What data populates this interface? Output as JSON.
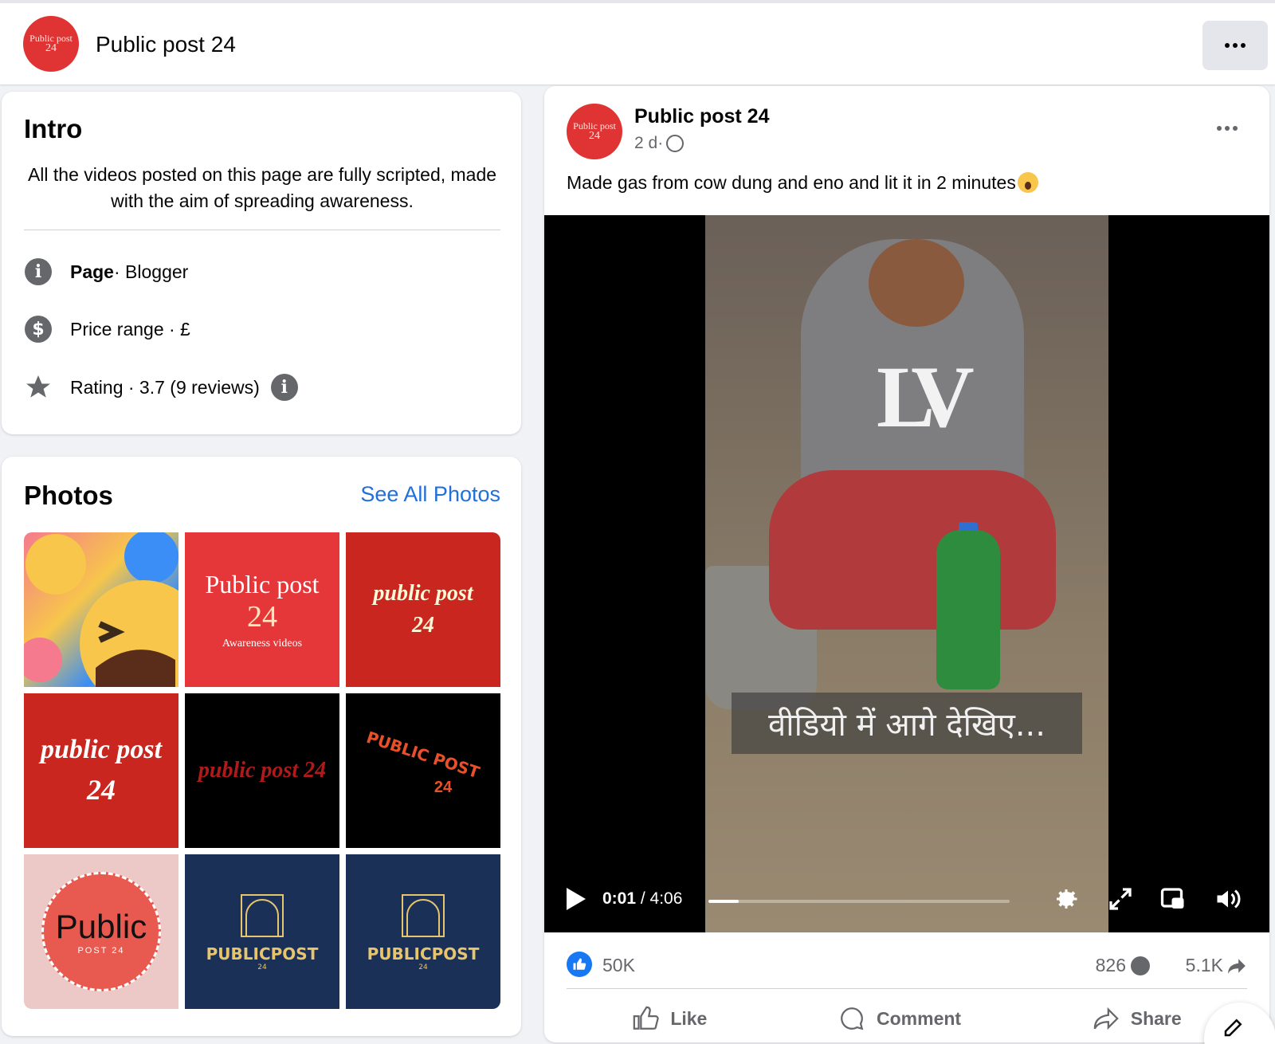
{
  "header": {
    "avatar_text_line1": "Public post",
    "avatar_text_line2": "24",
    "title": "Public post 24"
  },
  "intro": {
    "heading": "Intro",
    "bio": "All the videos posted on this page are fully scripted, made with the aim of spreading awareness.",
    "page_label": "Page",
    "page_category": " · Blogger",
    "price_range": "Price range · £",
    "rating": "Rating · 3.7 (9 reviews)"
  },
  "photos": {
    "heading": "Photos",
    "see_all": "See All Photos",
    "tiles": [
      {
        "kind": "emoji"
      },
      {
        "kind": "logo",
        "line1": "Public post",
        "line2": "24",
        "line3": "Awareness videos"
      },
      {
        "kind": "logo",
        "line1": "public post",
        "line2": "24"
      },
      {
        "kind": "logo",
        "line1": "public post",
        "line2": "24"
      },
      {
        "kind": "logo",
        "line1": "public post 24"
      },
      {
        "kind": "logo",
        "line1": "PUBLIC POST",
        "line2": "24"
      },
      {
        "kind": "logo",
        "line1": "Public",
        "line2": "POST 24"
      },
      {
        "kind": "logo",
        "line1": "PUBLICPOST",
        "line2": "24"
      },
      {
        "kind": "logo",
        "line1": "PUBLICPOST",
        "line2": "24"
      }
    ]
  },
  "post": {
    "author": "Public post 24",
    "time": "2 d·",
    "caption": "Made gas from cow dung and eno and lit it in 2 minutes",
    "video": {
      "subtitle": "वीडियो में आगे देखिए...",
      "shirt_text": "LV",
      "current_time": "0:01",
      "duration": " / 4:06",
      "progress": 0.1
    },
    "reactions": "50K",
    "comments": "826",
    "shares": "5.1K",
    "actions": {
      "like": "Like",
      "comment": "Comment",
      "share": "Share"
    }
  },
  "colors": {
    "brand_red": "#e03434",
    "link_blue": "#216fdb",
    "like_blue": "#1877f2"
  }
}
